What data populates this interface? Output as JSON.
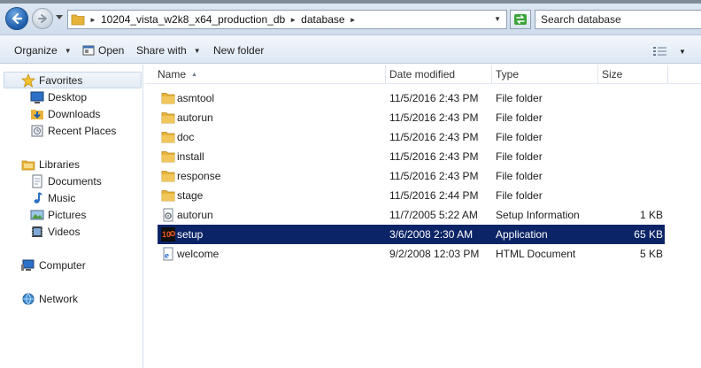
{
  "address_bar": {
    "breadcrumbs": [
      "10204_vista_w2k8_x64_production_db",
      "database"
    ],
    "search_placeholder": "Search database"
  },
  "toolbar": {
    "organize": "Organize",
    "open": "Open",
    "share_with": "Share with",
    "new_folder": "New folder"
  },
  "nav": {
    "favorites": "Favorites",
    "desktop": "Desktop",
    "downloads": "Downloads",
    "recent_places": "Recent Places",
    "libraries": "Libraries",
    "documents": "Documents",
    "music": "Music",
    "pictures": "Pictures",
    "videos": "Videos",
    "computer": "Computer",
    "network": "Network"
  },
  "columns": {
    "name": "Name",
    "date_modified": "Date modified",
    "type": "Type",
    "size": "Size"
  },
  "files": [
    {
      "name": "asmtool",
      "date": "11/5/2016 2:43 PM",
      "type": "File folder",
      "size": "",
      "icon": "folder-icon"
    },
    {
      "name": "autorun",
      "date": "11/5/2016 2:43 PM",
      "type": "File folder",
      "size": "",
      "icon": "folder-icon"
    },
    {
      "name": "doc",
      "date": "11/5/2016 2:43 PM",
      "type": "File folder",
      "size": "",
      "icon": "folder-icon"
    },
    {
      "name": "install",
      "date": "11/5/2016 2:43 PM",
      "type": "File folder",
      "size": "",
      "icon": "folder-icon"
    },
    {
      "name": "response",
      "date": "11/5/2016 2:43 PM",
      "type": "File folder",
      "size": "",
      "icon": "folder-icon"
    },
    {
      "name": "stage",
      "date": "11/5/2016 2:44 PM",
      "type": "File folder",
      "size": "",
      "icon": "folder-icon"
    },
    {
      "name": "autorun",
      "date": "11/7/2005 5:22 AM",
      "type": "Setup Information",
      "size": "1 KB",
      "icon": "setup-info-icon"
    },
    {
      "name": "setup",
      "date": "3/6/2008 2:30 AM",
      "type": "Application",
      "size": "65 KB",
      "icon": "oracle-app-icon",
      "selected": true
    },
    {
      "name": "welcome",
      "date": "9/2/2008 12:03 PM",
      "type": "HTML Document",
      "size": "5 KB",
      "icon": "html-doc-icon"
    }
  ],
  "colors": {
    "selection": "#0b2467",
    "folder": "#e8b339",
    "accent_blue": "#1e5ca8"
  }
}
